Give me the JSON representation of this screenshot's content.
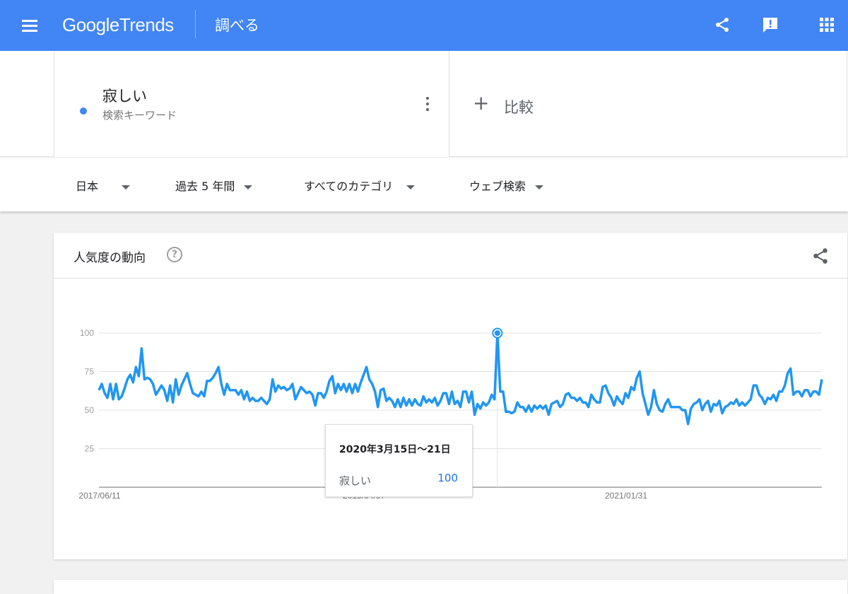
{
  "header": {
    "logo_google": "Google",
    "logo_trends": "Trends",
    "page_title": "調べる",
    "icons": [
      "menu-icon",
      "share-icon",
      "feedback-icon",
      "apps-grid-icon"
    ]
  },
  "search": {
    "term": "寂しい",
    "term_type": "検索キーワード",
    "term_color": "#4285f4",
    "compare_label": "比較"
  },
  "filters": {
    "region": "日本",
    "period": "過去 5 年間",
    "category": "すべてのカテゴリ",
    "search_type": "ウェブ検索"
  },
  "card": {
    "title": "人気度の動向",
    "help": "?"
  },
  "chart_data": {
    "type": "line",
    "series": [
      {
        "name": "寂しい",
        "color": "#2196f3",
        "values": [
          63,
          67,
          61,
          58,
          67,
          57,
          67,
          57,
          59,
          64,
          70,
          73,
          68,
          78,
          72,
          90,
          70,
          71,
          70,
          67,
          60,
          63,
          66,
          63,
          56,
          66,
          55,
          70,
          60,
          66,
          70,
          74,
          67,
          61,
          60,
          59,
          62,
          59,
          69,
          69,
          71,
          74,
          78,
          67,
          60,
          67,
          63,
          63,
          63,
          60,
          63,
          57,
          62,
          56,
          58,
          56,
          56,
          58,
          56,
          54,
          57,
          70,
          62,
          66,
          64,
          65,
          63,
          64,
          67,
          57,
          61,
          65,
          63,
          61,
          62,
          60,
          53,
          61,
          61,
          58,
          62,
          69,
          72,
          61,
          67,
          63,
          67,
          62,
          67,
          61,
          67,
          62,
          68,
          73,
          78,
          70,
          67,
          62,
          52,
          63,
          64,
          56,
          58,
          56,
          52,
          57,
          52,
          58,
          53,
          57,
          53,
          57,
          54,
          53,
          59,
          55,
          57,
          55,
          58,
          53,
          56,
          61,
          61,
          54,
          62,
          54,
          56,
          52,
          62,
          62,
          55,
          62,
          47,
          54,
          51,
          55,
          53,
          55,
          60,
          57,
          100,
          62,
          62,
          49,
          49,
          48,
          49,
          55,
          52,
          52,
          49,
          53,
          49,
          53,
          51,
          53,
          51,
          53,
          47,
          54,
          55,
          56,
          52,
          54,
          60,
          61,
          58,
          58,
          56,
          58,
          55,
          55,
          52,
          60,
          57,
          55,
          55,
          65,
          66,
          61,
          58,
          53,
          59,
          56,
          54,
          61,
          58,
          65,
          63,
          71,
          75,
          61,
          54,
          47,
          52,
          63,
          54,
          50,
          49,
          54,
          57,
          52,
          52,
          52,
          52,
          50,
          50,
          41,
          51,
          54,
          55,
          57,
          50,
          54,
          56,
          49,
          54,
          53,
          56,
          48,
          52,
          53,
          55,
          54,
          57,
          53,
          55,
          53,
          55,
          57,
          66,
          66,
          60,
          58,
          54,
          58,
          57,
          60,
          56,
          62,
          62,
          66,
          74,
          77,
          60,
          62,
          62,
          59,
          63,
          63,
          59,
          62,
          62,
          60,
          70
        ]
      }
    ],
    "y_ticks": [
      25,
      50,
      75,
      100
    ],
    "ylim": [
      0,
      100
    ],
    "x_tick_labels": [
      "2017/06/11",
      "2019/04/07",
      "2021/01/31"
    ],
    "peak": {
      "label": "2020年3月15日〜21日",
      "value": 100
    },
    "grid": true
  },
  "tooltip": {
    "date": "2020年3月15日〜21日",
    "term": "寂しい",
    "value": "100"
  }
}
